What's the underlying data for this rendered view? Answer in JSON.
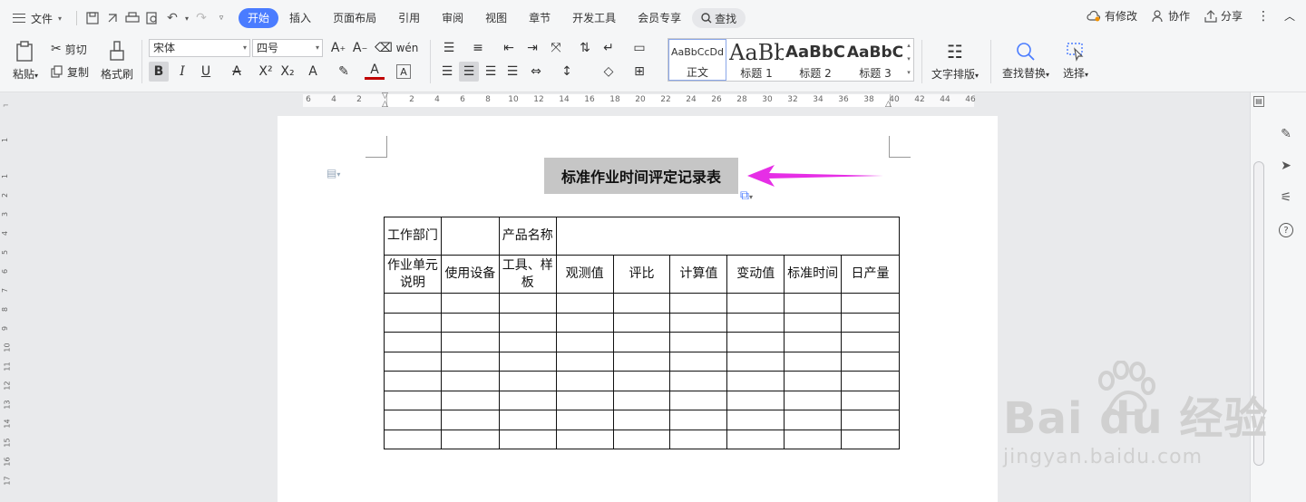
{
  "menu": {
    "file_label": "文件",
    "tabs": [
      "开始",
      "插入",
      "页面布局",
      "引用",
      "审阅",
      "视图",
      "章节",
      "开发工具",
      "会员专享"
    ],
    "search_label": "查找",
    "right": {
      "changes": "有修改",
      "collab": "协作",
      "share": "分享"
    }
  },
  "ribbon": {
    "paste": "粘贴",
    "cut": "剪切",
    "copy": "复制",
    "format_painter": "格式刷",
    "font_name": "宋体",
    "font_size": "四号",
    "styles": [
      {
        "preview": "AaBbCcDd",
        "label": "正文"
      },
      {
        "preview": "AaBb",
        "label": "标题 1"
      },
      {
        "preview": "AaBbC",
        "label": "标题 2"
      },
      {
        "preview": "AaBbC",
        "label": "标题 3"
      }
    ],
    "text_layout": "文字排版",
    "find_replace": "查找替换",
    "select": "选择"
  },
  "ruler": {
    "numbers": [
      "6",
      "4",
      "2",
      "2",
      "4",
      "6",
      "8",
      "10",
      "12",
      "14",
      "16",
      "18",
      "20",
      "22",
      "24",
      "26",
      "28",
      "30",
      "32",
      "34",
      "36",
      "38",
      "40",
      "42",
      "44",
      "46"
    ],
    "vertical_numbers": [
      "1",
      "1",
      "2",
      "3",
      "4",
      "5",
      "6",
      "7",
      "8",
      "9",
      "10",
      "11",
      "12",
      "13",
      "14",
      "15",
      "16",
      "17"
    ]
  },
  "document": {
    "title": "标准作业时间评定记录表",
    "row1": [
      "工作部门",
      "",
      "产品名称",
      ""
    ],
    "row2": [
      "作业单元说明",
      "使用设备",
      "工具、样板",
      "观测值",
      "评比",
      "计算值",
      "变动值",
      "标准时间",
      "日产量"
    ],
    "empty_rows": 8
  },
  "watermark": {
    "brand": "Bai du 经验",
    "url": "jingyan.baidu.com"
  },
  "colors": {
    "accent": "#4a7cff",
    "arrow": "#e62ee6",
    "selection": "#c6c6c6"
  }
}
